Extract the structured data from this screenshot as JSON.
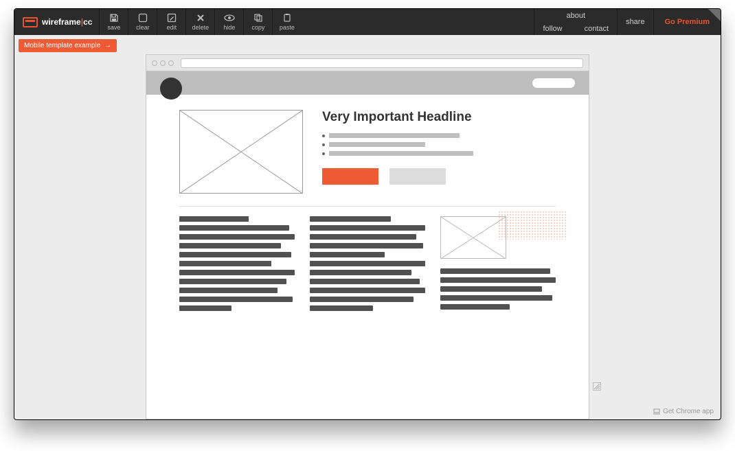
{
  "brand": {
    "name_a": "wireframe",
    "name_b": "cc"
  },
  "toolbar": {
    "save": "save",
    "clear": "clear",
    "edit": "edit",
    "delete": "delete",
    "hide": "hide",
    "copy": "copy",
    "paste": "paste"
  },
  "actions": {
    "about": "about",
    "follow": "follow",
    "contact": "contact",
    "share": "share",
    "premium": "Go Premium"
  },
  "tag": {
    "label": "Mobile template example",
    "arrow": "→"
  },
  "wireframe": {
    "headline": "Very Important Headline"
  },
  "footer": {
    "chrome": "Get Chrome app"
  }
}
